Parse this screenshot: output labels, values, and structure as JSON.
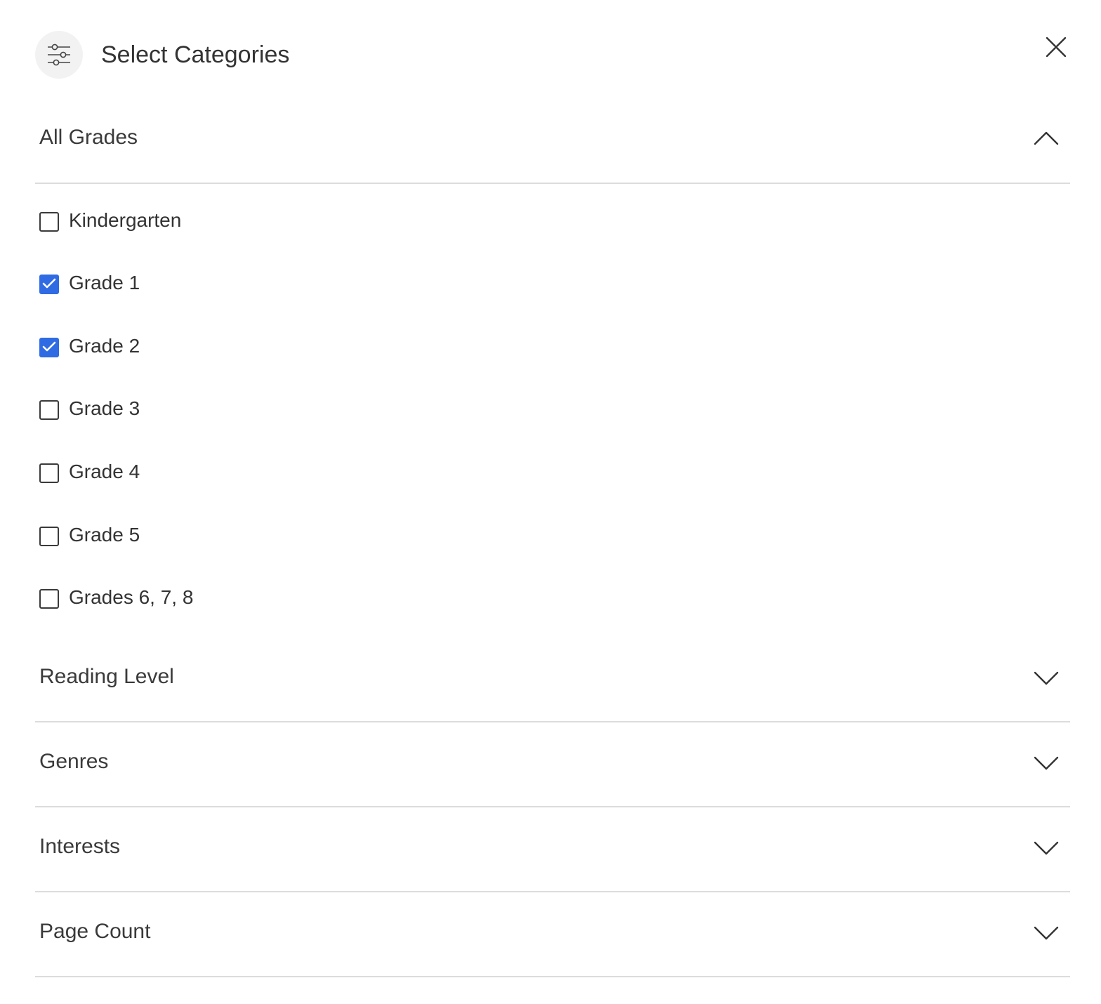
{
  "header": {
    "icon": "sliders-icon",
    "title": "Select Categories",
    "close_icon": "close-icon"
  },
  "sections": [
    {
      "label": "All Grades",
      "state": "expanded",
      "chevron_icon": "chevron-up-icon"
    },
    {
      "label": "Reading Level",
      "state": "collapsed",
      "chevron_icon": "chevron-down-icon"
    },
    {
      "label": "Genres",
      "state": "collapsed",
      "chevron_icon": "chevron-down-icon"
    },
    {
      "label": "Interests",
      "state": "collapsed",
      "chevron_icon": "chevron-down-icon"
    },
    {
      "label": "Page Count",
      "state": "collapsed",
      "chevron_icon": "chevron-down-icon"
    }
  ],
  "grades": [
    {
      "label": "Kindergarten",
      "checked": false
    },
    {
      "label": "Grade 1",
      "checked": true
    },
    {
      "label": "Grade 2",
      "checked": true
    },
    {
      "label": "Grade 3",
      "checked": false
    },
    {
      "label": "Grade 4",
      "checked": false
    },
    {
      "label": "Grade 5",
      "checked": false
    },
    {
      "label": "Grades 6, 7, 8",
      "checked": false
    }
  ],
  "colors": {
    "checkbox_checked": "#2f6be3",
    "divider": "#dcdcdc",
    "badge_background": "#f2f2f2"
  }
}
